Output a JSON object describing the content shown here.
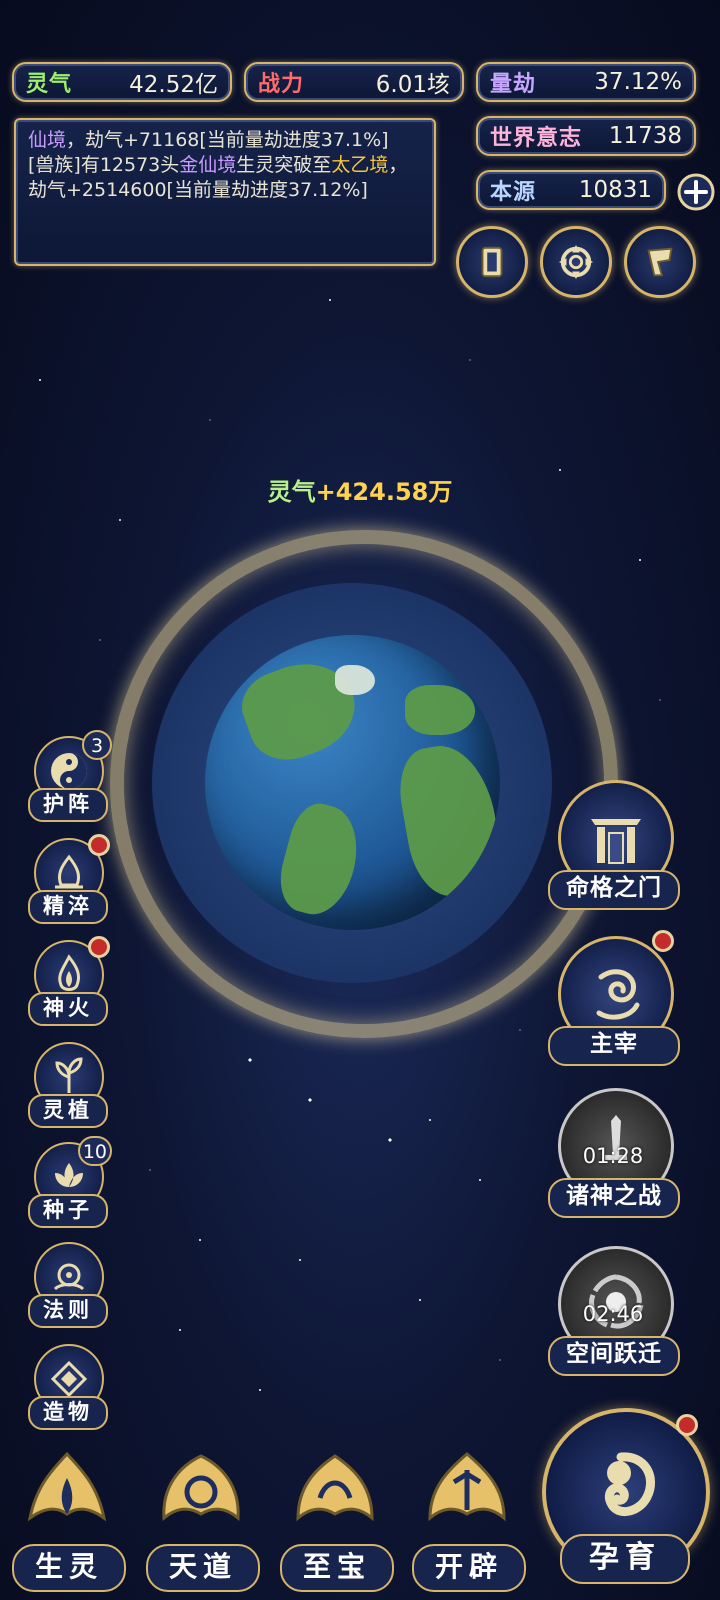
{
  "top_stats": {
    "lingqi": {
      "label": "灵气",
      "value": "42.52亿",
      "color": "#9cf06a"
    },
    "zhanli": {
      "label": "战力",
      "value": "6.01垓",
      "color": "#ff6a6a"
    },
    "liangjie": {
      "label": "量劫",
      "value": "37.12%",
      "color": "#c7a6ff"
    }
  },
  "right_stats": {
    "world_will": {
      "label": "世界意志",
      "value": "11738"
    },
    "origin": {
      "label": "本源",
      "value": "10831"
    }
  },
  "log": {
    "line1_purple": "仙境",
    "line1_rest": "，劫气+71168[当前量劫进度37.1%]",
    "line2_a": "[兽族]有12573头",
    "line2_purple": "金仙境",
    "line2_b": "生灵突破至",
    "line2_gold": "太乙境",
    "line2_c": "，劫气+2514600[当前量劫进度37.12%]"
  },
  "gain": {
    "label": "灵气",
    "value": "+424.58万"
  },
  "left_buttons": [
    {
      "label": "护阵",
      "badge": "3"
    },
    {
      "label": "精淬"
    },
    {
      "label": "神火"
    },
    {
      "label": "灵植"
    },
    {
      "label": "种子",
      "badge": "10"
    },
    {
      "label": "法则"
    },
    {
      "label": "造物"
    }
  ],
  "right_buttons": [
    {
      "label": "命格之门"
    },
    {
      "label": "主宰"
    },
    {
      "label": "诸神之战",
      "timer": "01:28"
    },
    {
      "label": "空间跃迁",
      "timer": "02:46"
    }
  ],
  "bottom_buttons": [
    {
      "label": "生灵"
    },
    {
      "label": "天道"
    },
    {
      "label": "至宝"
    },
    {
      "label": "开辟"
    }
  ],
  "main_button": {
    "label": "孕育"
  },
  "colors": {
    "gold": "#d6b46a",
    "panel": "#16234a",
    "notify_red": "#c42c2c"
  }
}
